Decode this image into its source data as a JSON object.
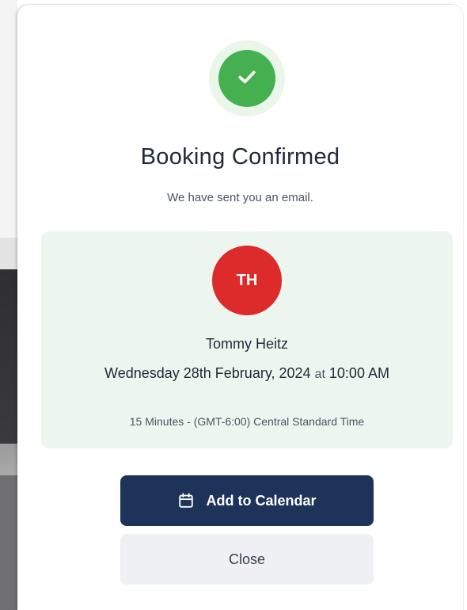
{
  "modal": {
    "title": "Booking Confirmed",
    "subtitle": "We have sent you an email.",
    "success_icon": "check-icon"
  },
  "booking": {
    "avatar_initials": "TH",
    "host_name": "Tommy Heitz",
    "date": "Wednesday 28th February, 2024",
    "at_word": "at",
    "time": "10:00 AM",
    "duration_timezone": "15 Minutes - (GMT-6:00) Central Standard Time"
  },
  "actions": {
    "add_to_calendar_label": "Add to Calendar",
    "add_to_calendar_icon": "calendar-icon",
    "close_label": "Close"
  },
  "colors": {
    "success": "#45b04f",
    "avatar": "#dd2a2a",
    "primary_button": "#1d335a",
    "card_background": "#ecf6ee"
  }
}
